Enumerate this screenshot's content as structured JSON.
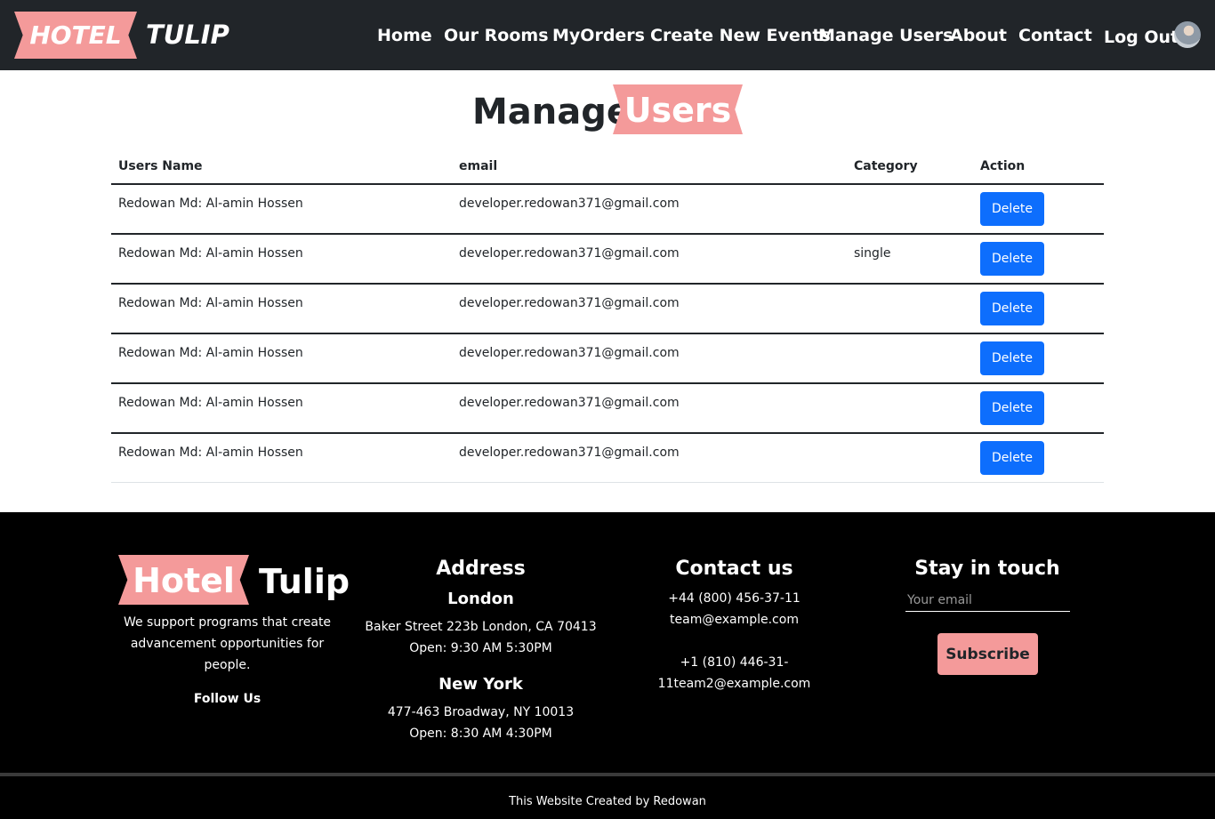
{
  "nav": {
    "brand_left": "HOTEL",
    "brand_right": "TULIP",
    "links": [
      "Home",
      "Our Rooms",
      "MyOrders",
      "Create New Events",
      "Manage Users",
      "About",
      "Contact"
    ],
    "logout": "Log Out",
    "accent_color": "#f49a9a"
  },
  "title": {
    "first": "Manage",
    "highlight": "Users"
  },
  "table": {
    "headers": [
      "Users Name",
      "email",
      "Category",
      "Action"
    ],
    "rows": [
      {
        "name": "Redowan Md: Al-amin Hossen",
        "email": "developer.redowan371@gmail.com",
        "category": "",
        "action": "Delete"
      },
      {
        "name": "Redowan Md: Al-amin Hossen",
        "email": "developer.redowan371@gmail.com",
        "category": "single",
        "action": "Delete"
      },
      {
        "name": "Redowan Md: Al-amin Hossen",
        "email": "developer.redowan371@gmail.com",
        "category": "",
        "action": "Delete"
      },
      {
        "name": "Redowan Md: Al-amin Hossen",
        "email": "developer.redowan371@gmail.com",
        "category": "",
        "action": "Delete"
      },
      {
        "name": "Redowan Md: Al-amin Hossen",
        "email": "developer.redowan371@gmail.com",
        "category": "",
        "action": "Delete"
      },
      {
        "name": "Redowan Md: Al-amin Hossen",
        "email": "developer.redowan371@gmail.com",
        "category": "",
        "action": "Delete"
      }
    ],
    "delete_color": "#0d6efd"
  },
  "footer": {
    "brand_left": "Hotel",
    "brand_right": "Tulip",
    "tagline": [
      "We support programs that create",
      "advancement opportunities for",
      "people."
    ],
    "follow": "Follow Us",
    "address": {
      "heading": "Address",
      "city1": "London",
      "city1_lines": [
        "Baker Street 223b London, CA 70413",
        "Open: 9:30 AM 5:30PM"
      ],
      "city2": "New York",
      "city2_lines": [
        "477-463 Broadway, NY 10013",
        "Open: 8:30 AM 4:30PM"
      ]
    },
    "contact": {
      "heading": "Contact us",
      "lines": [
        "+44 (800) 456-37-11",
        "team@example.com",
        "+1 (810) 446-31-",
        "11team2@example.com"
      ]
    },
    "stay": {
      "heading": "Stay in touch",
      "email_placeholder": "Your email",
      "subscribe": "Subscribe"
    },
    "credit": "This Website Created by Redowan"
  }
}
